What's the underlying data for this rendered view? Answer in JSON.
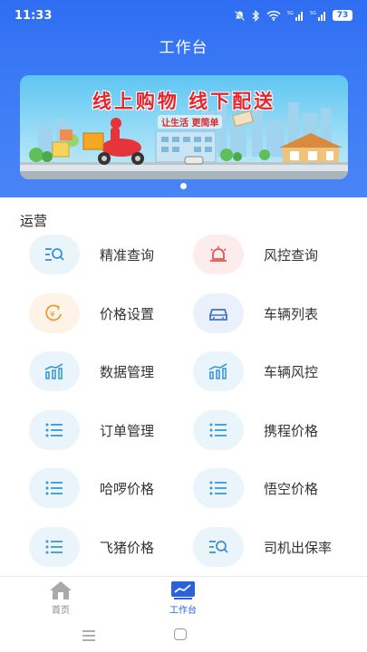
{
  "status_bar": {
    "time": "11:33",
    "battery": "73"
  },
  "header": {
    "title": "工作台"
  },
  "banner": {
    "headline": "线上购物  线下配送",
    "subline": "让生活 更简单"
  },
  "section": {
    "title": "运营"
  },
  "items": [
    {
      "label": "精准查询",
      "icon": "search-list-icon",
      "bg": "#e9f4fb",
      "color": "#3a8fd8"
    },
    {
      "label": "风控查询",
      "icon": "alarm-light-icon",
      "bg": "#fdecec",
      "color": "#e0564f"
    },
    {
      "label": "价格设置",
      "icon": "yen-price-icon",
      "bg": "#fdf3e6",
      "color": "#e79a3a"
    },
    {
      "label": "车辆列表",
      "icon": "car-icon",
      "bg": "#eaf0fc",
      "color": "#3d6fd4"
    },
    {
      "label": "数据管理",
      "icon": "bar-trend-icon",
      "bg": "#e9f4fb",
      "color": "#3a9ad8"
    },
    {
      "label": "车辆风控",
      "icon": "bar-trend-icon",
      "bg": "#e9f4fb",
      "color": "#3a9ad8"
    },
    {
      "label": "订单管理",
      "icon": "list-icon",
      "bg": "#e9f4fb",
      "color": "#3a9ad8"
    },
    {
      "label": "携程价格",
      "icon": "list-icon",
      "bg": "#e9f4fb",
      "color": "#3a9ad8"
    },
    {
      "label": "哈啰价格",
      "icon": "list-icon",
      "bg": "#e9f4fb",
      "color": "#3a9ad8"
    },
    {
      "label": "悟空价格",
      "icon": "list-icon",
      "bg": "#e9f4fb",
      "color": "#3a9ad8"
    },
    {
      "label": "飞猪价格",
      "icon": "list-icon",
      "bg": "#e9f4fb",
      "color": "#3a9ad8"
    },
    {
      "label": "司机出保率",
      "icon": "search-list-icon",
      "bg": "#e9f4fb",
      "color": "#3a8fd8"
    }
  ],
  "tabs": [
    {
      "label": "首页",
      "icon": "home-icon",
      "active": false
    },
    {
      "label": "工作台",
      "icon": "workbench-chart-icon",
      "active": true
    }
  ],
  "colors": {
    "primary": "#2f6df2",
    "tab_active": "#2a62d9",
    "tab_inactive": "#888888"
  }
}
